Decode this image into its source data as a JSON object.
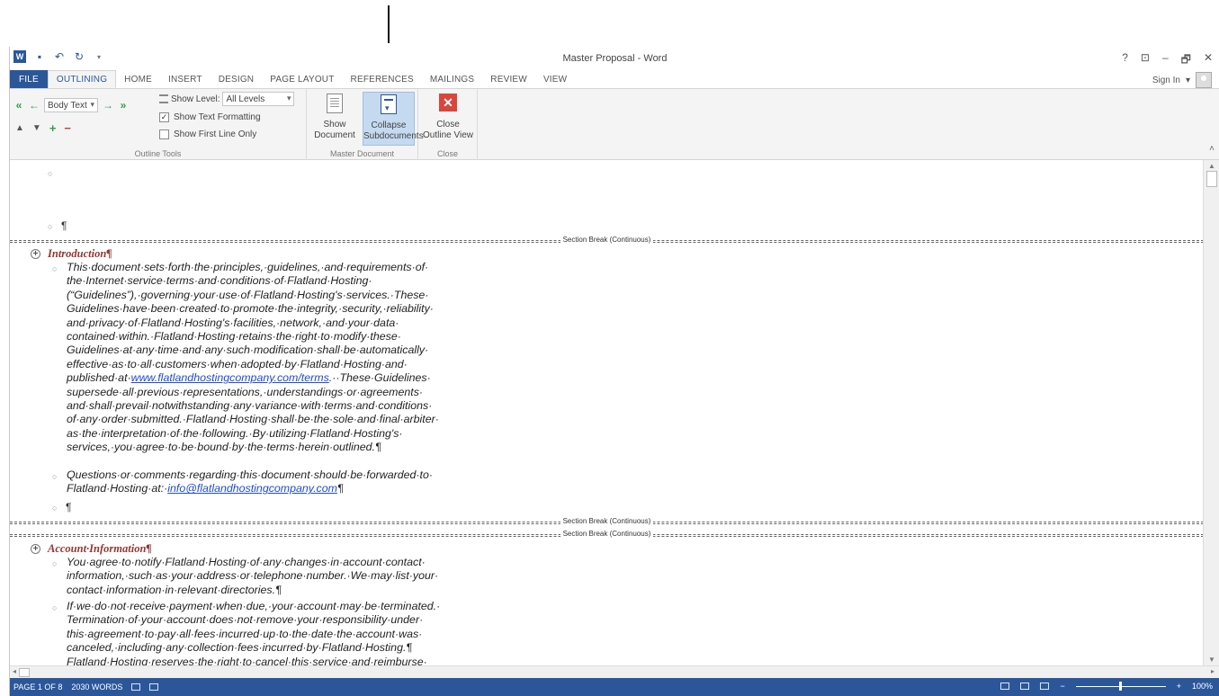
{
  "window": {
    "title": "Master Proposal - Word",
    "controls": [
      "?",
      "⊡",
      "–",
      "🗗",
      "✕"
    ]
  },
  "quick_access": [
    "word-logo",
    "save-icon",
    "undo-icon",
    "redo-icon",
    "customize-icon"
  ],
  "tabs": [
    "FILE",
    "OUTLINING",
    "HOME",
    "INSERT",
    "DESIGN",
    "PAGE LAYOUT",
    "REFERENCES",
    "MAILINGS",
    "REVIEW",
    "VIEW"
  ],
  "active_tab": "OUTLINING",
  "sign_in": "Sign In",
  "ribbon": {
    "outline_tools": {
      "label": "Outline Tools",
      "level": "Body Text",
      "show_level_label": "Show Level:",
      "show_level_value": "All Levels",
      "show_text_formatting": "Show Text Formatting",
      "show_text_formatting_checked": true,
      "show_first_line_only": "Show First Line Only",
      "show_first_line_only_checked": false
    },
    "master_document": {
      "label": "Master Document",
      "show_document_line1": "Show",
      "show_document_line2": "Document",
      "collapse_line1": "Collapse",
      "collapse_line2": "Subdocuments"
    },
    "close": {
      "label": "Close",
      "close_line1": "Close",
      "close_line2": "Outline View"
    }
  },
  "document": {
    "empty_pilcrow": "¶",
    "section_break_label": "Section Break (Continuous)",
    "sections": [
      {
        "heading": "Introduction¶",
        "paragraphs": [
          {
            "lines": [
              "This·document·sets·forth·the·principles,·guidelines,·and·requirements·of·",
              "the·Internet·service·terms·and·conditions·of·Flatland·Hosting·",
              "(“Guidelines”),·governing·your·use·of·Flatland·Hosting's·services.·These·",
              "Guidelines·have·been·created·to·promote·the·integrity,·security,·reliability·",
              "and·privacy·of·Flatland·Hosting's·facilities,·network,·and·your·data·",
              "contained·within.·Flatland·Hosting·retains·the·right·to·modify·these·",
              "Guidelines·at·any·time·and·any·such·modification·shall·be·automatically·",
              "effective·as·to·all·customers·when·adopted·by·Flatland·Hosting·and·"
            ],
            "link_line_prefix": "published·at·",
            "link": "www.flatlandhostingcompany.com/terms",
            "link_line_suffix": ".··These·Guidelines·",
            "lines_after": [
              "supersede·all·previous·representations,·understandings·or·agreements·",
              "and·shall·prevail·notwithstanding·any·variance·with·terms·and·conditions·",
              "of·any·order·submitted.·Flatland·Hosting·shall·be·the·sole·and·final·arbiter·",
              "as·the·interpretation·of·the·following.·By·utilizing·Flatland·Hosting's·",
              "services,·you·agree·to·be·bound·by·the·terms·herein·outlined.¶"
            ]
          },
          {
            "line1": "Questions·or·comments·regarding·this·document·should·be·forwarded·to·",
            "line2_prefix": "Flatland·Hosting·at:·",
            "link": "info@flatlandhostingcompany.com",
            "line2_suffix": "¶"
          }
        ]
      },
      {
        "heading": "Account·Information¶",
        "paragraphs": [
          {
            "lines": [
              "You·agree·to·notify·Flatland·Hosting·of·any·changes·in·account·contact·",
              "information,·such·as·your·address·or·telephone·number.·We·may·list·your·",
              "contact·information·in·relevant·directories.¶"
            ]
          },
          {
            "lines": [
              "If·we·do·not·receive·payment·when·due,·your·account·may·be·terminated.·",
              "Termination·of·your·account·does·not·remove·your·responsibility·under·",
              "this·agreement·to·pay·all·fees·incurred·up·to·the·date·the·account·was·",
              "canceled,·including·any·collection·fees·incurred·by·Flatland·Hosting.¶",
              "Flatland·Hosting·reserves·the·right·to·cancel·this·service·and·reimburse·"
            ]
          }
        ]
      }
    ]
  },
  "status_bar": {
    "page": "PAGE 1 OF 8",
    "words": "2030 WORDS",
    "zoom": "100%"
  }
}
